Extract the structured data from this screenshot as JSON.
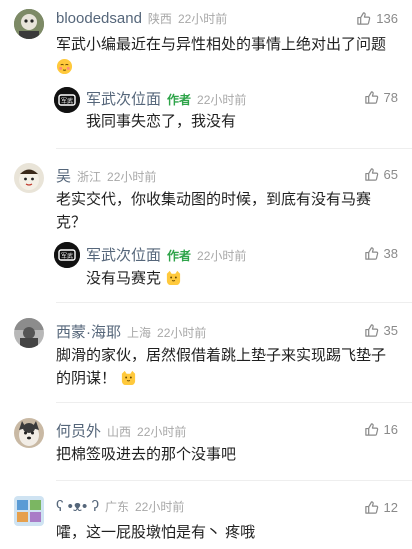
{
  "comments": [
    {
      "user": "bloodedsand",
      "location": "陕西",
      "time": "22小时前",
      "likes": "136",
      "text": "军武小编最近在与异性相处的事情上绝对出了问题",
      "reply": {
        "user": "军武次位面",
        "tag": "作者",
        "time": "22小时前",
        "likes": "78",
        "text": "我同事失恋了，我没有"
      }
    },
    {
      "user": "吴",
      "location": "浙江",
      "time": "22小时前",
      "likes": "65",
      "text_line1": "老实交代，你收集动图的时候，到底有没有马赛",
      "text_line2": "克？",
      "reply": {
        "user": "军武次位面",
        "tag": "作者",
        "time": "22小时前",
        "likes": "38",
        "text": "没有马赛克"
      }
    },
    {
      "user": "西蒙·海耶",
      "location": "上海",
      "time": "22小时前",
      "likes": "35",
      "text_line1": "脚滑的家伙，居然假借着跳上垫子来实现踢飞垫子",
      "text_line2": "的阴谋！"
    },
    {
      "user": "何员外",
      "location": "山西",
      "time": "22小时前",
      "likes": "16",
      "text": "把棉签吸进去的那个没事吧"
    },
    {
      "user": "ʕ •ᴥ• ʔ",
      "location": "广东",
      "time": "22小时前",
      "likes": "12",
      "text": "嚯，这一屁股墩怕是有丶 疼哦"
    }
  ],
  "colors": {
    "name": "#55667a",
    "meta": "#a8a8a8",
    "author_tag": "#2fa44a",
    "text": "#1f1f1f"
  },
  "icons": {
    "like": "thumbs-up-icon",
    "emoji_blush": "blushing-face-icon",
    "emoji_cat": "cat-face-icon"
  }
}
